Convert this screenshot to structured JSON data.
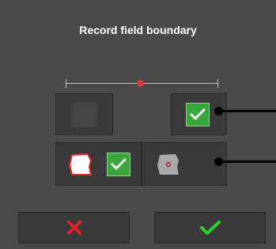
{
  "dialog": {
    "title": "Record field boundary"
  },
  "slider": {
    "value_fraction": 0.49
  },
  "options": {
    "row1": {
      "left": {
        "icon": "blank-square-icon",
        "checked": false
      },
      "right": {
        "icon": "checkmark-icon",
        "checked": true
      }
    },
    "row2": {
      "left": {
        "icon": "field-boundary-red-icon",
        "checked": true
      },
      "right": {
        "icon": "field-boundary-gray-icon",
        "checked": false
      }
    }
  },
  "buttons": {
    "cancel_icon": "x-icon",
    "confirm_icon": "checkmark-icon"
  },
  "colors": {
    "background": "#4a4a4a",
    "accent_green": "#3aa53a",
    "cancel_red": "#e0242b",
    "confirm_green": "#2bd12b",
    "slider_thumb": "#d9363e"
  }
}
